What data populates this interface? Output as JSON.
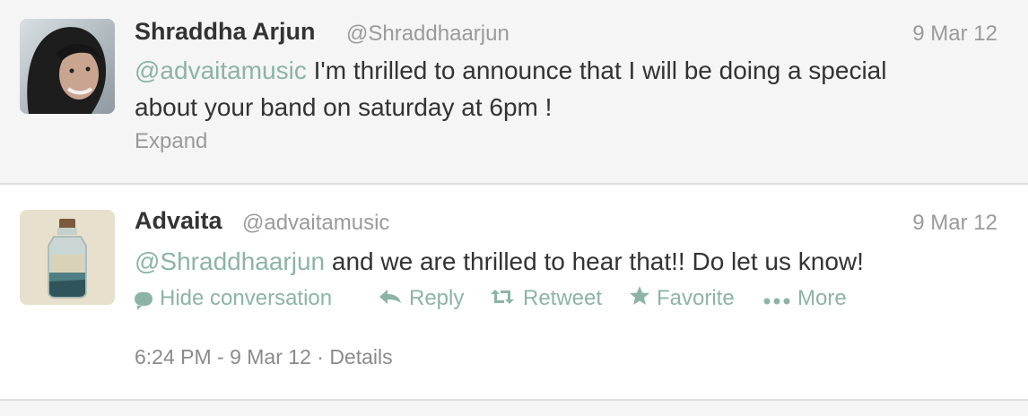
{
  "tweets": [
    {
      "name": "Shraddha Arjun",
      "handle": "@Shraddhaarjun",
      "date": "9 Mar 12",
      "mention": "@advaitamusic",
      "text_line1": " I'm thrilled to announce that I will be doing a special",
      "text_line2": "about your band on saturday at 6pm !",
      "expand": "Expand"
    },
    {
      "name": "Advaita",
      "handle": "@advaitamusic",
      "date": "9 Mar 12",
      "mention": "@Shraddhaarjun",
      "text": " and we are thrilled to hear that!! Do let us know!",
      "actions": {
        "hide_conversation": "Hide conversation",
        "reply": "Reply",
        "retweet": "Retweet",
        "favorite": "Favorite",
        "more": "More"
      },
      "meta": {
        "time": "6:24 PM - 9 Mar 12",
        "separator": " · ",
        "details": "Details"
      }
    }
  ],
  "colors": {
    "accent": "#8db3a7",
    "muted": "#9a9a9a",
    "text": "#333333",
    "row_bg": "#f5f5f5"
  },
  "icons": {
    "hide_conversation": "speech-bubble-icon",
    "reply": "reply-arrow-icon",
    "retweet": "retweet-icon",
    "favorite": "star-icon",
    "more": "ellipsis-icon"
  }
}
